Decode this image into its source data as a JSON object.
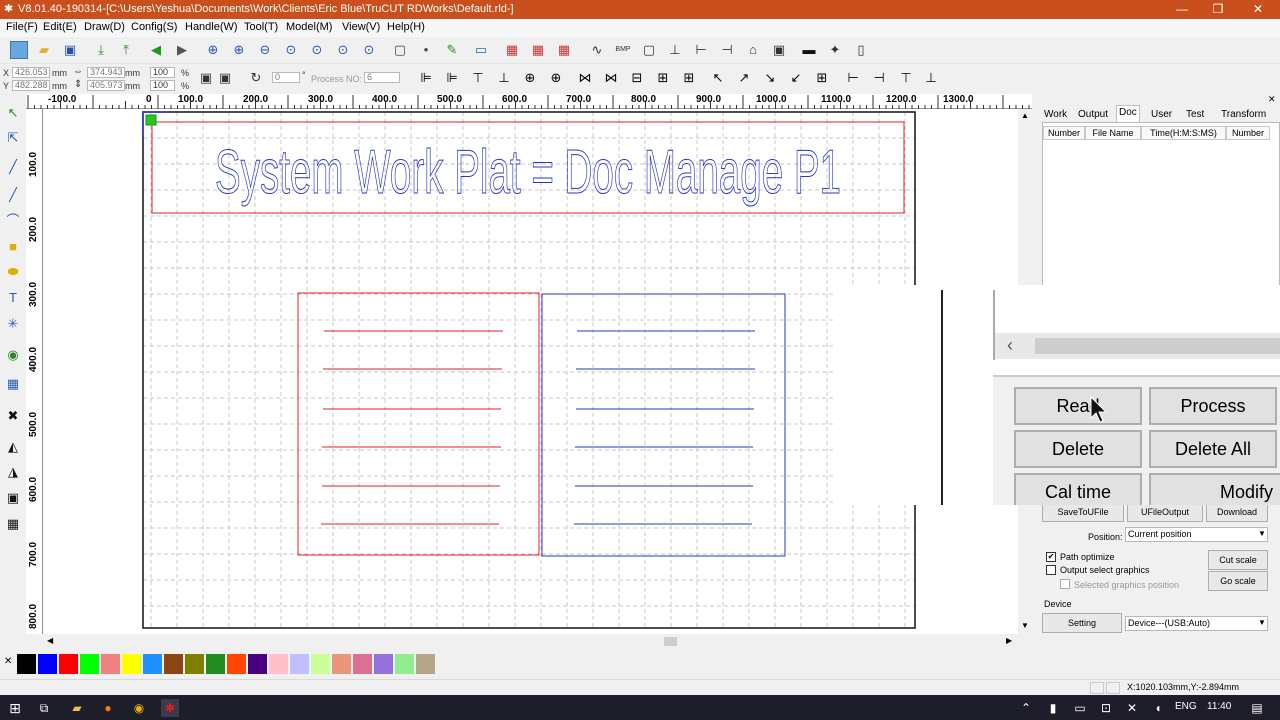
{
  "window": {
    "title": "V8.01.40-190314-[C:\\Users\\Yeshua\\Documents\\Work\\Clients\\Eric Blue\\TruCUT RDWorks\\Default.rld-]",
    "minimize": "—",
    "maximize": "❐",
    "close": "✕"
  },
  "menu": [
    "File(F)",
    "Edit(E)",
    "Draw(D)",
    "Config(S)",
    "Handle(W)",
    "Tool(T)",
    "Model(M)",
    "View(V)",
    "Help(H)"
  ],
  "props": {
    "x_label": "X",
    "y_label": "Y",
    "x_value": "426.053",
    "y_value": "482.288",
    "unit_mm": "mm",
    "width_value": "374.943",
    "height_value": "405.973",
    "scale_w": "100",
    "scale_h": "100",
    "unit_pct": "%",
    "rotate_value": "0",
    "degree_sign": "°",
    "process_no_label": "Process NO:",
    "process_no_value": "6"
  },
  "ruler": {
    "top_ticks": [
      "-100.0",
      "0",
      "100.0",
      "200.0",
      "300.0",
      "400.0",
      "500.0",
      "600.0",
      "700.0",
      "800.0",
      "900.0",
      "1000.0",
      "1100.0",
      "1200.0",
      "1300.0"
    ],
    "left_ticks": [
      "100.0",
      "200.0",
      "300.0",
      "400.0",
      "500.0",
      "600.0",
      "700.0",
      "800.0"
    ]
  },
  "canvas": {
    "title_text": "System Work Plat = Doc Manage P1",
    "accent_red": "#e0202a",
    "accent_blue": "#2a35c8"
  },
  "panel": {
    "tabs": [
      "Work",
      "Output",
      "Doc",
      "User",
      "Test",
      "Transform"
    ],
    "active_tab": "Doc",
    "columns": [
      "Number",
      "File Name",
      "Time(H:M:S:MS)",
      "Number"
    ],
    "buttons_small": [
      "SaveToUFile",
      "UFileOutput",
      "Download"
    ],
    "position_label": "Position:",
    "position_value": "Current position",
    "path_optimize": "Path optimize",
    "output_select": "Output select graphics",
    "selected_pos": "Selected graphics position",
    "cut_scale": "Cut scale",
    "go_scale": "Go scale",
    "device_label": "Device",
    "setting": "Setting",
    "device_value": "Device---(USB:Auto)"
  },
  "zoom_buttons": {
    "read": "Read",
    "process": "Process",
    "delete": "Delete",
    "delete_all": "Delete All",
    "cal_time": "Cal time",
    "modify": "Modify"
  },
  "status": {
    "coords": "X:1020.103mm,Y:-2.894mm"
  },
  "colors": [
    "#000000",
    "#0000ff",
    "#ff0000",
    "#00ff00",
    "#f08080",
    "#ffff00",
    "#1e90ff",
    "#8b4513",
    "#808000",
    "#228b22",
    "#ff4500",
    "#4b0082",
    "#ffc0cb",
    "#c0c0ff",
    "#ccff99",
    "#e9967a",
    "#db7093",
    "#9370db",
    "#90ee90",
    "#b5a68a"
  ],
  "taskbar": {
    "lang": "ENG",
    "time": "11:40"
  }
}
